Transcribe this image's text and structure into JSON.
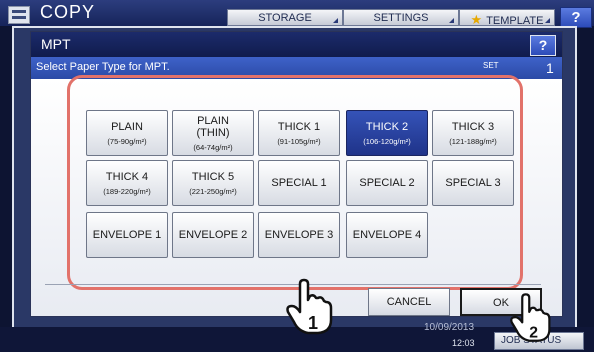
{
  "app": {
    "title": "COPY",
    "icon": "copier-icon"
  },
  "top_tabs": [
    {
      "label": "STORAGE"
    },
    {
      "label": "SETTINGS"
    },
    {
      "label": "TEMPLATE",
      "icon": "star-icon"
    }
  ],
  "top_help": "?",
  "dialog": {
    "title": "MPT",
    "help": "?",
    "instruction": "Select Paper Type for MPT.",
    "set_label": "SET",
    "set_count": "1"
  },
  "paper_types": [
    {
      "name": "PLAIN",
      "weight": "(75-90g/m²)",
      "selected": false
    },
    {
      "name": "PLAIN\n(THIN)",
      "weight": "(64-74g/m²)",
      "selected": false
    },
    {
      "name": "THICK 1",
      "weight": "(91-105g/m²)",
      "selected": false
    },
    {
      "name": "THICK 2",
      "weight": "(106-120g/m²)",
      "selected": true
    },
    {
      "name": "THICK 3",
      "weight": "(121-188g/m²)",
      "selected": false
    },
    {
      "name": "THICK 4",
      "weight": "(189-220g/m²)",
      "selected": false
    },
    {
      "name": "THICK 5",
      "weight": "(221-250g/m²)",
      "selected": false
    },
    {
      "name": "SPECIAL 1",
      "weight": "",
      "selected": false
    },
    {
      "name": "SPECIAL 2",
      "weight": "",
      "selected": false
    },
    {
      "name": "SPECIAL 3",
      "weight": "",
      "selected": false
    },
    {
      "name": "ENVELOPE 1",
      "weight": "",
      "selected": false
    },
    {
      "name": "ENVELOPE 2",
      "weight": "",
      "selected": false
    },
    {
      "name": "ENVELOPE 3",
      "weight": "",
      "selected": false
    },
    {
      "name": "ENVELOPE 4",
      "weight": "",
      "selected": false
    }
  ],
  "buttons": {
    "cancel": "CANCEL",
    "ok": "OK"
  },
  "status": {
    "date": "10/09/2013",
    "time": "12:03",
    "job_status": "JOB STATUS"
  },
  "annotations": {
    "step1": "1",
    "step2": "2"
  },
  "colors": {
    "highlight": "#e2726a",
    "selected": "#1f3389",
    "header": "#101c4d"
  }
}
